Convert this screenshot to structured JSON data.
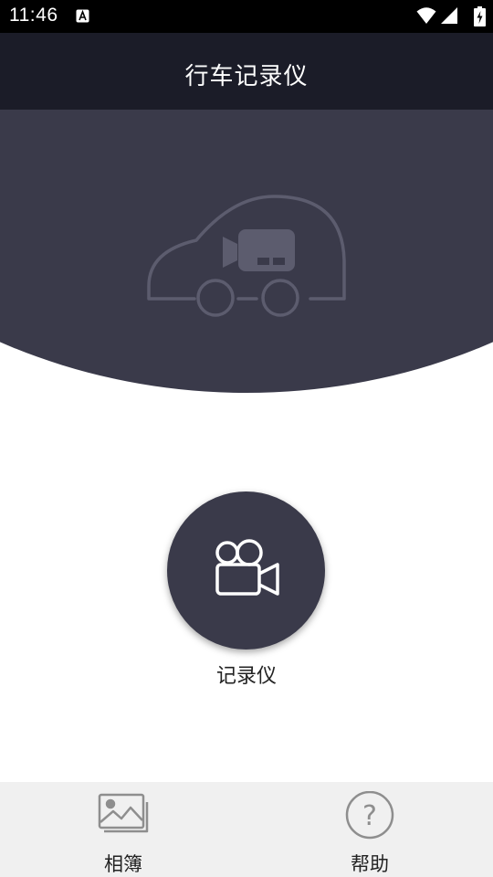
{
  "status_bar": {
    "time": "11:46",
    "icons": [
      "a-notification-icon",
      "wifi-icon",
      "signal-icon",
      "battery-charging-icon"
    ]
  },
  "header": {
    "title": "行车记录仪"
  },
  "hero": {
    "illustration": "car-camera-icon",
    "background_color": "#3a3a4a"
  },
  "main": {
    "recorder": {
      "icon": "video-camera-icon",
      "label": "记录仪"
    }
  },
  "bottom_nav": {
    "items": [
      {
        "label": "相簿",
        "icon": "album-icon"
      },
      {
        "label": "帮助",
        "icon": "help-icon"
      }
    ]
  },
  "colors": {
    "title_bar": "#1b1c28",
    "dark_accent": "#3a3a4a",
    "nav_background": "#f0f0f0",
    "status_bar": "#000000"
  }
}
